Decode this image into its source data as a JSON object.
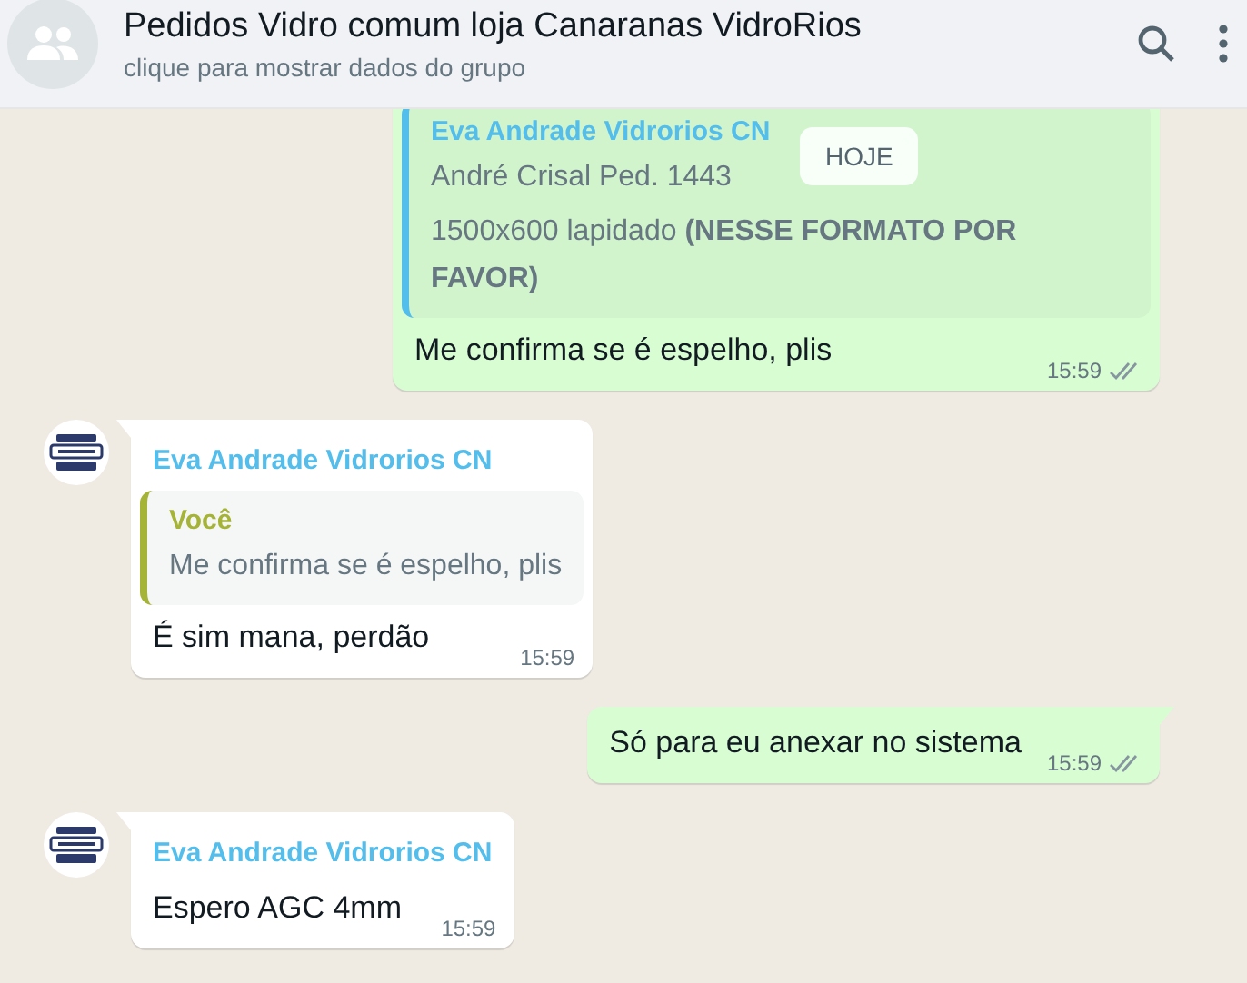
{
  "header": {
    "title": "Pedidos Vidro comum loja Canaranas VidroRios",
    "subtitle": "clique para mostrar dados do grupo"
  },
  "date_badge": "HOJE",
  "messages": [
    {
      "kind": "outgoing",
      "quote": {
        "author": "Eva Andrade Vidrorios CN",
        "lines": [
          "André Crisal Ped. 1443",
          "1500x600 lapidado **(NESSE FORMATO POR FAVOR)**"
        ],
        "color": "#53bdeb"
      },
      "text": "Me confirma se é espelho, plis",
      "time": "15:59",
      "read": true
    },
    {
      "kind": "incoming",
      "sender": "Eva Andrade Vidrorios CN",
      "quote": {
        "author": "Você",
        "lines": [
          "Me confirma se é espelho, plis"
        ],
        "color": "#a5b337"
      },
      "text": "É sim mana, perdão",
      "time": "15:59"
    },
    {
      "kind": "outgoing",
      "text": "Só para eu anexar no sistema",
      "time": "15:59",
      "read": true
    },
    {
      "kind": "incoming",
      "sender": "Eva Andrade Vidrorios CN",
      "text": "Espero AGC 4mm",
      "time": "15:59"
    }
  ]
}
